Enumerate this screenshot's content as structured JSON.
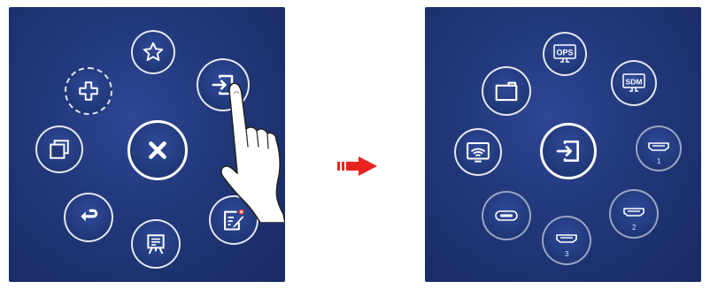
{
  "left_menu": {
    "items": [
      {
        "name": "favorite",
        "icon": "star-icon"
      },
      {
        "name": "add",
        "icon": "plus-icon"
      },
      {
        "name": "input-source",
        "icon": "input-icon"
      },
      {
        "name": "multi-window",
        "icon": "windows-icon"
      },
      {
        "name": "close",
        "icon": "close-icon"
      },
      {
        "name": "back",
        "icon": "return-icon"
      },
      {
        "name": "annotate",
        "icon": "annotate-icon"
      },
      {
        "name": "whiteboard",
        "icon": "whiteboard-icon"
      }
    ]
  },
  "transition_arrow": {
    "icon": "right-arrow-icon",
    "color": "#e8231f"
  },
  "right_menu": {
    "center": {
      "icon": "input-icon"
    },
    "sources": {
      "ops_label": "OPS",
      "sdm_label": "SDM",
      "hdmi1_label": "1",
      "hdmi2_label": "2",
      "hdmi3_label": "3"
    }
  },
  "colors": {
    "panel_bg": "#213779",
    "icon": "#ffffff",
    "arrow": "#e8231f"
  }
}
